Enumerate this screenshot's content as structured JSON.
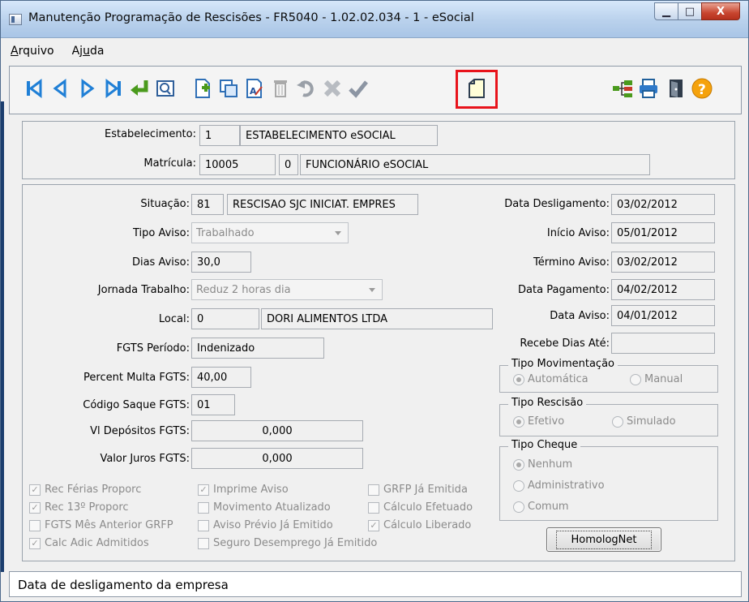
{
  "window": {
    "title": "Manutenção Programação de Rescisões - FR5040 - 1.02.02.034 - 1 - eSocial",
    "min_glyph": "▁",
    "max_glyph": "□",
    "close_glyph": "X"
  },
  "menu": [
    {
      "label_prefix": "",
      "label_underline": "A",
      "label_suffix": "rquivo"
    },
    {
      "label_prefix": "Aj",
      "label_underline": "u",
      "label_suffix": "da"
    }
  ],
  "toolbar_icons": [
    "first-record-icon",
    "previous-record-icon",
    "next-record-icon",
    "last-record-icon",
    "goto-icon",
    "search-icon",
    "add-record-icon",
    "copy-record-icon",
    "edit-record-icon",
    "delete-record-icon",
    "undo-icon",
    "cancel-icon",
    "save-icon",
    "new-document-icon",
    "tree-icon",
    "print-icon",
    "exit-icon",
    "help-icon"
  ],
  "header": {
    "estabelecimento_label": "Estabelecimento:",
    "estabelecimento_code": "1",
    "estabelecimento_name": "ESTABELECIMENTO eSOCIAL",
    "matricula_label": "Matrícula:",
    "matricula_code": "10005",
    "matricula_digit": "0",
    "matricula_name": "FUNCIONÁRIO eSOCIAL"
  },
  "form": {
    "situacao_label": "Situação:",
    "situacao_code": "81",
    "situacao_desc": "RESCISAO SJC INICIAT. EMPRES",
    "tipo_aviso_label": "Tipo Aviso:",
    "tipo_aviso_value": "Trabalhado",
    "dias_aviso_label": "Dias Aviso:",
    "dias_aviso_value": "30,0",
    "jornada_label": "Jornada Trabalho:",
    "jornada_value": "Reduz 2 horas dia",
    "local_label": "Local:",
    "local_code": "0",
    "local_name": "DORI ALIMENTOS LTDA",
    "fgts_periodo_label": "FGTS Período:",
    "fgts_periodo_value": "Indenizado",
    "percent_multa_label": "Percent Multa FGTS:",
    "percent_multa_value": "40,00",
    "codigo_saque_label": "Código Saque FGTS:",
    "codigo_saque_value": "01",
    "vl_depositos_label": "Vl Depósitos FGTS:",
    "vl_depositos_value": "0,000",
    "valor_juros_label": "Valor Juros FGTS:",
    "valor_juros_value": "0,000",
    "data_desligamento_label": "Data Desligamento:",
    "data_desligamento_value": "03/02/2012",
    "inicio_aviso_label": "Início Aviso:",
    "inicio_aviso_value": "05/01/2012",
    "termino_aviso_label": "Término Aviso:",
    "termino_aviso_value": "03/02/2012",
    "data_pagamento_label": "Data Pagamento:",
    "data_pagamento_value": "04/02/2012",
    "data_aviso_label": "Data Aviso:",
    "data_aviso_value": "04/01/2012",
    "recebe_dias_label": "Recebe Dias Até:",
    "recebe_dias_value": ""
  },
  "tipo_movimentacao": {
    "title": "Tipo Movimentação",
    "options": [
      "Automática",
      "Manual"
    ],
    "selected": 0
  },
  "tipo_rescisao": {
    "title": "Tipo Rescisão",
    "options": [
      "Efetivo",
      "Simulado"
    ],
    "selected": 0
  },
  "tipo_cheque": {
    "title": "Tipo Cheque",
    "options": [
      "Nenhum",
      "Administrativo",
      "Comum"
    ],
    "selected": 0
  },
  "checkboxes": [
    {
      "label": "Rec Férias Proporc",
      "checked": true
    },
    {
      "label": "Rec 13º Proporc",
      "checked": true
    },
    {
      "label": "FGTS Mês Anterior GRFP",
      "checked": false
    },
    {
      "label": "Calc Adic Admitidos",
      "checked": true
    },
    {
      "label": "Imprime Aviso",
      "checked": true
    },
    {
      "label": "Movimento Atualizado",
      "checked": false
    },
    {
      "label": "Aviso Prévio Já Emitido",
      "checked": false
    },
    {
      "label": "Seguro Desemprego Já Emitido",
      "checked": false
    },
    {
      "label": "GRFP Já Emitida",
      "checked": false
    },
    {
      "label": "Cálculo Efetuado",
      "checked": false
    },
    {
      "label": "Cálculo Liberado",
      "checked": true
    }
  ],
  "check_glyph": "✓",
  "homolognet_label": "HomologNet",
  "status_text": "Data de desligamento da empresa",
  "colors": {
    "highlight": "#e8131b",
    "toolbar_blue": "#1f7fd6",
    "toolbar_green": "#4a9a1c"
  }
}
